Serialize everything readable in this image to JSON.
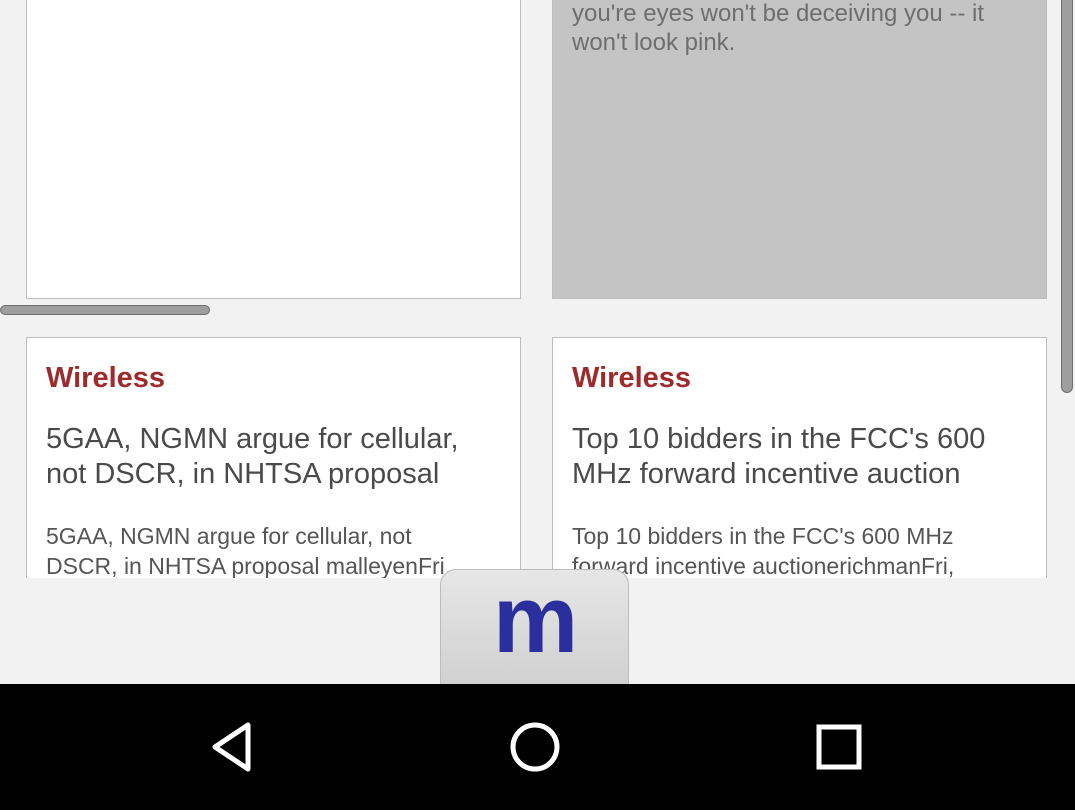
{
  "top_cards": {
    "right_text_line1": "you're eyes won't be deceiving you -- it",
    "right_text_line2": "won't look pink."
  },
  "articles": [
    {
      "category": "Wireless",
      "headline": "5GAA, NGMN argue for cellular, not DSCR, in NHTSA proposal",
      "excerpt_line1": "5GAA, NGMN argue for cellular, not",
      "excerpt_line2": "DSCR, in NHTSA proposal malleyenFri,"
    },
    {
      "category": "Wireless",
      "headline": "Top 10 bidders in the FCC's 600 MHz forward incentive auction",
      "excerpt_line1": "Top 10 bidders in the FCC's 600 MHz",
      "excerpt_line2": "forward incentive auctionerichmanFri,"
    }
  ],
  "logo": {
    "letter": "m",
    "color": "#2b2f9e"
  },
  "colors": {
    "category": "#9e2a2b",
    "navbar": "#000000"
  },
  "navbar": {
    "icons": [
      "back-triangle-icon",
      "home-circle-icon",
      "recents-square-icon"
    ]
  }
}
